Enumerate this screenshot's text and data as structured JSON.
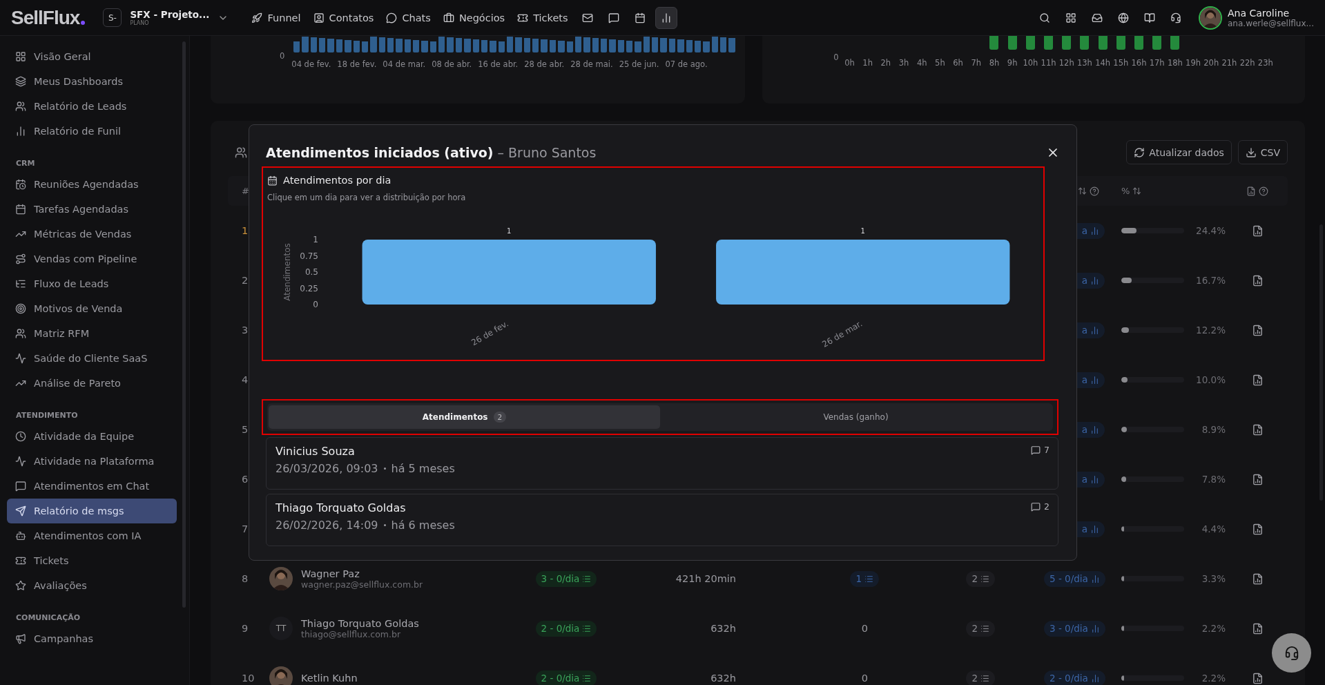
{
  "topbar": {
    "logo": "SellFlux",
    "workspace": {
      "badge": "S-",
      "name": "SFX - Projeto...",
      "plan": "PLANO"
    },
    "nav": [
      {
        "label": "Funnel"
      },
      {
        "label": "Contatos"
      },
      {
        "label": "Chats"
      },
      {
        "label": "Negócios"
      },
      {
        "label": "Tickets"
      }
    ],
    "nav_icons": [
      {
        "selected": false
      },
      {
        "selected": false
      },
      {
        "selected": false
      },
      {
        "selected": true
      }
    ],
    "user": {
      "name": "Ana Caroline",
      "email": "ana.werle@sellflux..."
    }
  },
  "sidebar": {
    "sections": [
      {
        "items": [
          {
            "label": "Visão Geral",
            "selected": false
          },
          {
            "label": "Meus Dashboards",
            "selected": false
          },
          {
            "label": "Relatório de Leads",
            "selected": false
          },
          {
            "label": "Relatório de Funil",
            "selected": false
          }
        ]
      },
      {
        "title": "CRM",
        "items": [
          {
            "label": "Reuniões Agendadas",
            "selected": false
          },
          {
            "label": "Tarefas Agendadas",
            "selected": false
          },
          {
            "label": "Métricas de Vendas",
            "selected": false
          },
          {
            "label": "Vendas com Pipeline",
            "selected": false
          },
          {
            "label": "Fluxo de Leads",
            "selected": false
          },
          {
            "label": "Motivos de Venda",
            "selected": false
          },
          {
            "label": "Matriz RFM",
            "selected": false
          },
          {
            "label": "Saúde do Cliente SaaS",
            "selected": false
          },
          {
            "label": "Análise de Pareto",
            "selected": false
          }
        ]
      },
      {
        "title": "ATENDIMENTO",
        "items": [
          {
            "label": "Atividade da Equipe",
            "selected": false
          },
          {
            "label": "Atividade na Plataforma",
            "selected": false
          },
          {
            "label": "Atendimentos em Chat",
            "selected": false
          },
          {
            "label": "Relatório de msgs",
            "selected": true
          },
          {
            "label": "Atendimentos com IA",
            "selected": false
          },
          {
            "label": "Tickets",
            "selected": false
          },
          {
            "label": "Avaliações",
            "selected": false
          }
        ]
      },
      {
        "title": "COMUNICAÇÃO",
        "items": [
          {
            "label": "Campanhas",
            "selected": false
          }
        ]
      }
    ]
  },
  "overview_charts": [
    {
      "axis_zero": "0",
      "labels": [
        "04 de fev.",
        "18 de fev.",
        "04 de mar.",
        "08 de abr.",
        "16 de abr.",
        "28 de abr.",
        "28 de mai.",
        "25 de jun.",
        "07 de ago."
      ]
    },
    {
      "axis_zero": "0",
      "hours": [
        {
          "label": "0h",
          "active": false
        },
        {
          "label": "1h",
          "active": false
        },
        {
          "label": "2h",
          "active": false
        },
        {
          "label": "3h",
          "active": false
        },
        {
          "label": "4h",
          "active": false
        },
        {
          "label": "5h",
          "active": false
        },
        {
          "label": "6h",
          "active": false
        },
        {
          "label": "7h",
          "active": false
        },
        {
          "label": "8h",
          "active": true
        },
        {
          "label": "9h",
          "active": true
        },
        {
          "label": "10h",
          "active": true
        },
        {
          "label": "11h",
          "active": true
        },
        {
          "label": "12h",
          "active": true
        },
        {
          "label": "13h",
          "active": true
        },
        {
          "label": "14h",
          "active": true
        },
        {
          "label": "15h",
          "active": true
        },
        {
          "label": "16h",
          "active": true
        },
        {
          "label": "17h",
          "active": true
        },
        {
          "label": "18h",
          "active": true
        },
        {
          "label": "19h",
          "active": false
        },
        {
          "label": "20h",
          "active": false
        },
        {
          "label": "21h",
          "active": false
        },
        {
          "label": "22h",
          "active": false
        },
        {
          "label": "23h",
          "active": false
        }
      ]
    }
  ],
  "table": {
    "actions": [
      "Atualizar dados",
      "CSV"
    ],
    "header": {
      "number": "#",
      "percent": "%"
    },
    "rows": [
      {
        "number": "1",
        "top": true,
        "rate_tail": "a",
        "level": 0.244,
        "percent": "24.4%"
      },
      {
        "number": "2",
        "top": false,
        "rate_tail": "a",
        "level": 0.167,
        "percent": "16.7%"
      },
      {
        "number": "3",
        "top": false,
        "rate_tail": "a",
        "level": 0.122,
        "percent": "12.2%"
      },
      {
        "number": "4",
        "top": false,
        "rate_tail": "a",
        "level": 0.1,
        "percent": "10.0%"
      },
      {
        "number": "5",
        "top": false,
        "rate_tail": "a",
        "level": 0.089,
        "percent": "8.9%"
      },
      {
        "number": "6",
        "top": false,
        "rate_tail": "a",
        "level": 0.078,
        "percent": "7.8%"
      },
      {
        "number": "7",
        "top": false,
        "rate_tail": "a",
        "level": 0.044,
        "percent": "4.4%"
      },
      {
        "number": "8",
        "top": false,
        "name": "Wagner Paz",
        "email": "wagner.paz@sellflux.com.br",
        "rate": "3 - 0/dia",
        "time": "421h 20min",
        "col4": "1",
        "col4_chip": true,
        "col5": "2",
        "rate2": "5 - 0/dia",
        "level": 0.033,
        "percent": "3.3%"
      },
      {
        "number": "9",
        "top": false,
        "avatar_initials": "TT",
        "name": "Thiago Torquato Goldas",
        "email": "thiago@sellflux.com.br",
        "rate": "2 - 0/dia",
        "time": "632h",
        "col4": "0",
        "col4_chip": false,
        "col5": "2",
        "rate2": "3 - 0/dia",
        "level": 0.022,
        "percent": "2.2%"
      },
      {
        "number": "10",
        "top": false,
        "name": "Ketlin Kuhn",
        "rate": "2 - 0/dia",
        "time": "632h",
        "col4": "0",
        "col4_chip": false,
        "col5": "2",
        "rate2": "2 - 0/dia",
        "level": 0.022,
        "percent": "2.2%"
      }
    ]
  },
  "modal": {
    "title": "Atendimentos iniciados (ativo)",
    "subtitle": "– Bruno Santos",
    "chart_section": {
      "highlighted": true,
      "title": "Atendimentos por dia",
      "hint": "Clique em um dia para ver a distribuição por hora",
      "chart_data": {
        "type": "bar",
        "ylabel": "Atendimentos",
        "categories": [
          "26 de fev.",
          "26 de mar."
        ],
        "values": [
          1,
          1
        ],
        "ylim": [
          0,
          1
        ],
        "yticks": [
          {
            "value": 1,
            "label": "1"
          },
          {
            "value": 0.75,
            "label": "0.75"
          },
          {
            "value": 0.5,
            "label": "0.5"
          },
          {
            "value": 0.25,
            "label": "0.25"
          },
          {
            "value": 0,
            "label": "0"
          }
        ],
        "value_labels": [
          "1",
          "1"
        ]
      }
    },
    "tabs": {
      "highlighted": true,
      "items": [
        {
          "label": "Atendimentos",
          "count": "2",
          "selected": true
        },
        {
          "label": "Vendas (ganho)",
          "selected": false
        }
      ]
    },
    "items": [
      {
        "name": "Vinicius Souza",
        "date": "26/03/2026, 09:03",
        "ago": "há 5 meses",
        "messages": "7"
      },
      {
        "name": "Thiago Torquato Goldas",
        "date": "26/02/2026, 14:09",
        "ago": "há 6 meses",
        "messages": "2"
      }
    ]
  }
}
